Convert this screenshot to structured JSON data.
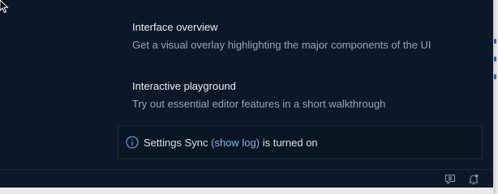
{
  "walkthroughs": [
    {
      "title": "Interface overview",
      "description": "Get a visual overlay highlighting the major components of the UI"
    },
    {
      "title": "Interactive playground",
      "description": "Try out essential editor features in a short walkthrough"
    }
  ],
  "notification": {
    "icon": "info-icon",
    "prefix": "Settings Sync",
    "link_text": "(show log)",
    "suffix": "is turned on"
  },
  "status_bar": {
    "icons": [
      "feedback-icon",
      "notifications-bell-icon"
    ]
  },
  "colors": {
    "background": "#0c1827",
    "link": "#7fb8e6",
    "title_text": "#e6ebf1",
    "description_text": "#9aa6b4"
  }
}
